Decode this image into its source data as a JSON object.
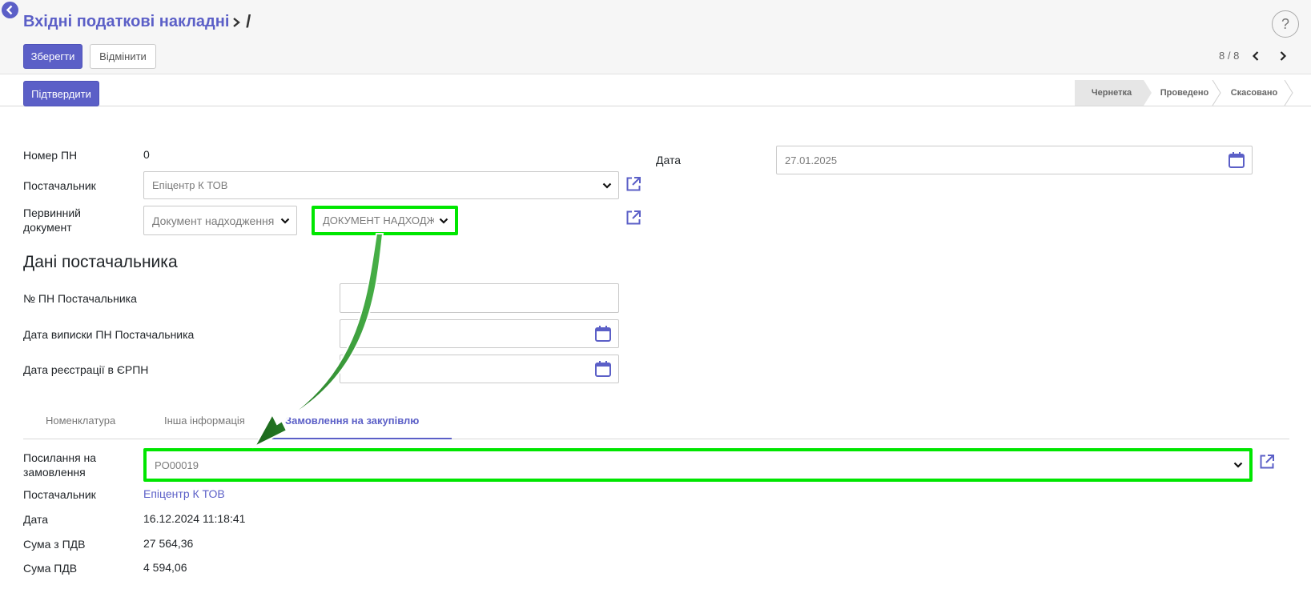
{
  "header": {
    "title": "Вхідні податкові накладні",
    "separator": "/",
    "save_label": "Зберегти",
    "discard_label": "Відмінити",
    "pager": "8 / 8",
    "help": "?"
  },
  "statusbar": {
    "confirm_label": "Підтвердити",
    "steps": [
      "Чернетка",
      "Проведено",
      "Скасовано"
    ],
    "active_step": "Чернетка"
  },
  "form": {
    "number_label": "Номер ПН",
    "number_value": "0",
    "supplier_label": "Постачальник",
    "supplier_value": "Епіцентр К ТОВ",
    "primary_doc_label_1": "Первинний",
    "primary_doc_label_2": "документ",
    "primary_doc_type": "Документ надходження",
    "primary_doc_ref": "ДОКУМЕНТ НАДХОДЖЕННЯ",
    "date_label": "Дата",
    "date_value": "27.01.2025"
  },
  "supplier_data": {
    "title": "Дані постачальника",
    "num_label": "№ ПН Постачальника",
    "issue_date_label": "Дата виписки ПН Постачальника",
    "reg_date_label": "Дата реєстрації в ЄРПН"
  },
  "tabs": [
    "Номенклатура",
    "Інша інформація",
    "Замовлення на закупівлю"
  ],
  "order": {
    "ref_label_1": "Посилання на",
    "ref_label_2": "замовлення",
    "ref_value": "PO00019",
    "supplier_label": "Постачальник",
    "supplier_value": "Епіцентр К ТОВ",
    "date_label": "Дата",
    "date_value": "16.12.2024 11:18:41",
    "total_label": "Сума з ПДВ",
    "total_value": "27 564,36",
    "vat_label": "Сума ПДВ",
    "vat_value": "4 594,06"
  },
  "colors": {
    "accent": "#5b5fc7",
    "highlight": "#00e600",
    "arrow": "#1e8a1e"
  },
  "icons": [
    "back-icon",
    "help-icon",
    "chevron-left-icon",
    "chevron-right-icon",
    "chevron-down-icon",
    "calendar-icon",
    "external-link-icon",
    "arrow-annotation"
  ]
}
